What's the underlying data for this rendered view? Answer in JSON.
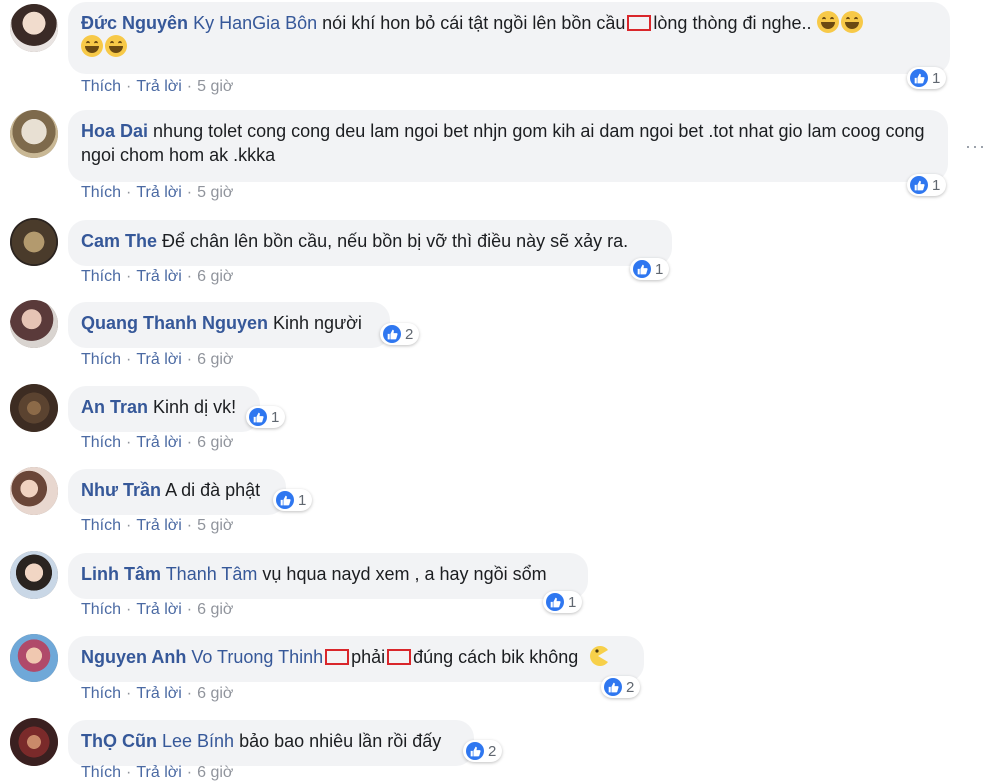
{
  "comments": [
    {
      "author": "Đức Nguyên",
      "mention": "Ky HanGia Bôn",
      "text_before": "nói khí hon bỏ cái tật ngồi lên bồn cầu",
      "text_after": "lòng thòng đi nghe..",
      "like": "Thích",
      "reply": "Trả lời",
      "time": "5 giờ",
      "reactions": "1"
    },
    {
      "author": "Hoa Dai",
      "text": "nhung tolet cong cong deu lam ngoi bet nhjn gom kih ai dam ngoi bet .tot nhat gio lam coog cong ngoi chom hom ak .kkka",
      "like": "Thích",
      "reply": "Trả lời",
      "time": "5 giờ",
      "reactions": "1"
    },
    {
      "author": "Cam The",
      "text": "Để chân lên bồn cầu, nếu bồn bị vỡ thì điều này sẽ xảy ra.",
      "like": "Thích",
      "reply": "Trả lời",
      "time": "6 giờ",
      "reactions": "1"
    },
    {
      "author": "Quang Thanh Nguyen",
      "text": "Kinh người",
      "like": "Thích",
      "reply": "Trả lời",
      "time": "6 giờ",
      "reactions": "2"
    },
    {
      "author": "An Tran",
      "text": "Kinh dị vk!",
      "like": "Thích",
      "reply": "Trả lời",
      "time": "6 giờ",
      "reactions": "1"
    },
    {
      "author": "Như Trần",
      "text": "A di đà phật",
      "like": "Thích",
      "reply": "Trả lời",
      "time": "5 giờ",
      "reactions": "1"
    },
    {
      "author": "Linh Tâm",
      "mention": "Thanh Tâm",
      "text": "vụ hqua nayd xem , a hay ngồi sổm",
      "like": "Thích",
      "reply": "Trả lời",
      "time": "6 giờ",
      "reactions": "1"
    },
    {
      "author": "Nguyen Anh",
      "mention": "Vo Truong Thinh",
      "text_mid": "phải",
      "text_after": "đúng cách bik không",
      "like": "Thích",
      "reply": "Trả lời",
      "time": "6 giờ",
      "reactions": "2"
    },
    {
      "author": "ThỌ Cũn",
      "mention": "Lee Bính",
      "text": "bảo bao nhiêu lần rồi đấy",
      "like": "Thích",
      "reply": "Trả lời",
      "time": "6 giờ",
      "reactions": "2"
    }
  ],
  "more_options": "···",
  "colors": {
    "link": "#365899",
    "bubble": "#f2f3f5",
    "like": "#2f77f0",
    "meta": "#90949c"
  },
  "icons": [
    "laughing-emoji-icon",
    "pacman-emoji-icon",
    "like-reaction-icon",
    "more-options-icon"
  ]
}
